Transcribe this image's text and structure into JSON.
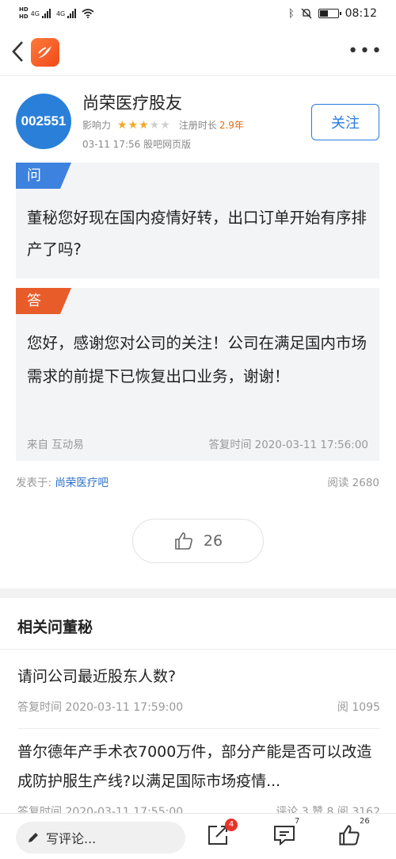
{
  "status_bar": {
    "network_left": "4G",
    "network_right": "4G",
    "hd_label": "HD",
    "time": "08:12",
    "battery_level": 0.45
  },
  "nav": {
    "back": "<",
    "more": "•••"
  },
  "user": {
    "avatar_text": "002551",
    "name": "尚荣医疗股友",
    "influence_label": "影响力",
    "stars_filled": 3,
    "stars_total": 5,
    "reg_label": "注册时长",
    "reg_value": "2.9年",
    "post_meta": "03-11 17:56 股吧网页版",
    "follow_label": "关注"
  },
  "question": {
    "tag": "问",
    "text": "董秘您好现在国内疫情好转，出口订单开始有序排产了吗?"
  },
  "answer": {
    "tag": "答",
    "text": "您好，感谢您对公司的关注！公司在满足国内市场需求的前提下已恢复出口业务，谢谢！",
    "source": "来自 互动易",
    "time": "答复时间 2020-03-11 17:56:00"
  },
  "publish": {
    "label": "发表于:",
    "forum": "尚荣医疗吧",
    "read": "阅读 2680"
  },
  "like": {
    "count": "26"
  },
  "related": {
    "title": "相关问董秘",
    "items": [
      {
        "question": "请问公司最近股东人数?",
        "time": "答复时间 2020-03-11 17:59:00",
        "stats": "阅 1095"
      },
      {
        "question": "普尔德年产手术衣7000万件，部分产能是否可以改造成防护服生产线?以满足国际市场疫情...",
        "time": "答复时间 2020-03-11 17:55:00",
        "stats": "评论 3 赞 8 阅 3162"
      }
    ]
  },
  "bottom_bar": {
    "comment_placeholder": "写评论...",
    "share_badge": "4",
    "comment_count": "7",
    "like_count": "26"
  }
}
